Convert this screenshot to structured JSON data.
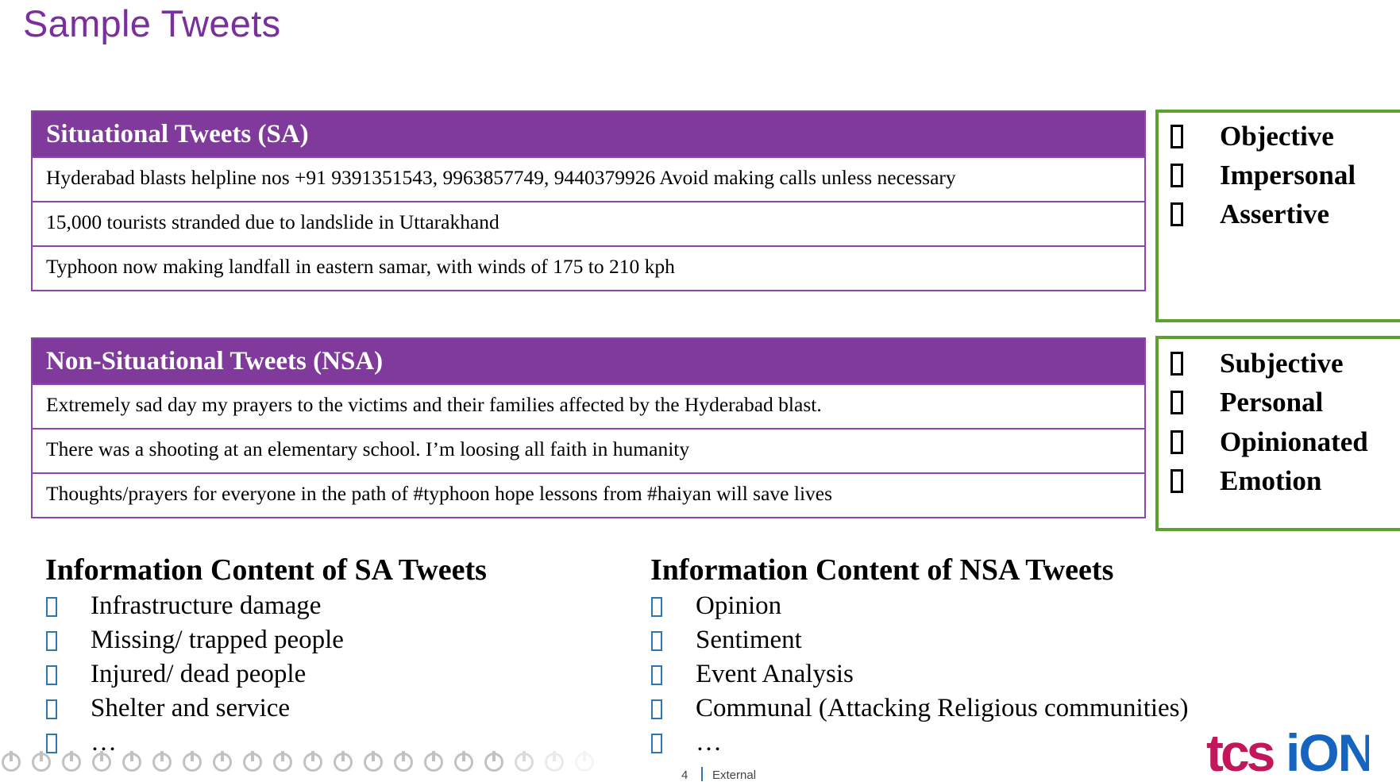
{
  "title": "Sample Tweets",
  "sa_table": {
    "header": "Situational Tweets (SA)",
    "rows": [
      "Hyderabad blasts helpline nos +91 9391351543, 9963857749, 9440379926 Avoid making calls unless necessary",
      "15,000 tourists stranded due to landslide in Uttarakhand",
      "Typhoon now making landfall in eastern samar, with winds of 175 to 210 kph"
    ]
  },
  "nsa_table": {
    "header": "Non-Situational Tweets (NSA)",
    "rows": [
      "Extremely sad day my prayers to the victims and their families affected by the Hyderabad blast.",
      "There was a shooting at an elementary school. I’m loosing all faith in humanity",
      "Thoughts/prayers for everyone in the path of #typhoon hope lessons from #haiyan will save lives"
    ]
  },
  "sa_properties": [
    "Objective",
    "Impersonal",
    "Assertive"
  ],
  "nsa_properties": [
    "Subjective",
    "Personal",
    "Opinionated",
    "Emotion"
  ],
  "info_sa": {
    "heading": "Information Content of SA Tweets",
    "items": [
      "Infrastructure damage",
      "Missing/ trapped people",
      "Injured/ dead people",
      "Shelter and service",
      "…"
    ]
  },
  "info_nsa": {
    "heading": "Information Content of NSA Tweets",
    "items": [
      "Opinion",
      "Sentiment",
      "Event Analysis",
      "Communal (Attacking Religious communities)",
      "…"
    ]
  },
  "footer": {
    "page_number": "4",
    "classification": "External"
  },
  "logo": {
    "text_left": "tcs",
    "text_right": "iON"
  },
  "colors": {
    "title": "#7B2F9E",
    "table_header": "#7F3A9C",
    "table_border": "#8E44AD",
    "property_border": "#5DA02E",
    "bullet": "#2E75B6",
    "logo_tcs": "#C2185B",
    "logo_ion": "#1565C0"
  }
}
